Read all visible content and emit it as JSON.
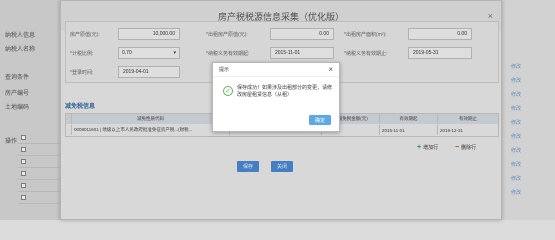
{
  "background": {
    "side_labels": [
      "纳税人信息",
      "纳税人名称",
      "查询条件",
      "房产编号",
      "土地编码",
      "房产编号",
      "操作"
    ],
    "row_links": [
      "修改",
      "修改",
      "修改",
      "修改",
      "修改",
      "修改",
      "修改",
      "修改",
      "修改",
      "修改"
    ]
  },
  "dialog": {
    "title": "房产税税源信息采集（优化版）",
    "close": "×",
    "form": {
      "row1": {
        "label1": "房产原值(元):",
        "value1": "10,000.00",
        "label2": "*出租房产原值(元):",
        "value2": "0.00",
        "label3": "*出租房产面积(m²):",
        "value3": "0.00"
      },
      "row2": {
        "label1": "*计税比例:",
        "value1": "0.70",
        "label2": "*纳税义务有效期起:",
        "value2": "2015-11-01",
        "label3": "*纳税义务有效期止:",
        "value3": "2019-05-31"
      },
      "row3": {
        "label1": "*登录时间:",
        "value1": "2019-04-01"
      }
    },
    "section_title": "减免税信息",
    "grid": {
      "headers": [
        "",
        "减免性质代码",
        "",
        "月减免税金额(元)",
        "有效期起",
        "有效期止"
      ],
      "row": [
        "",
        "0008011601 | 地级以上市人民政府批准免征房产税...(财税...",
        "",
        "0.01",
        "2015-11-01",
        "2019-12-31"
      ]
    },
    "add_row": "增加行",
    "del_row": "删除行",
    "save": "保存",
    "cancel": "关闭"
  },
  "alert": {
    "title": "提示",
    "close": "×",
    "message": "保存成功！如果涉及出租部分的变更，请修改房屋租赁信息（从租）",
    "ok": "确定"
  },
  "colors": {
    "accent": "#4a8ad4",
    "success": "#5cb85c",
    "danger": "#c0392b"
  }
}
